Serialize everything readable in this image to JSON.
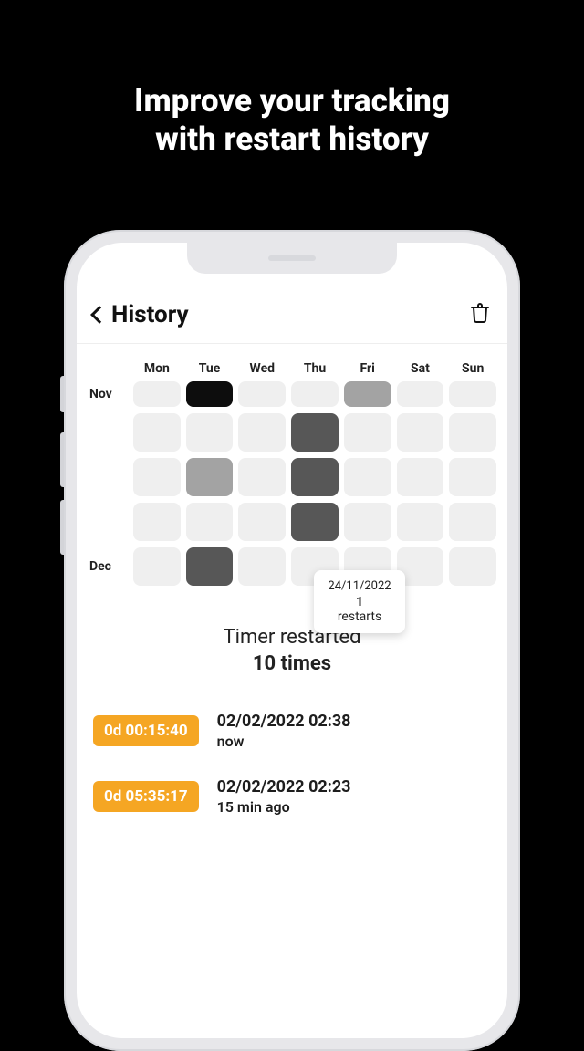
{
  "hero": {
    "line1": "Improve your tracking",
    "line2": "with restart history"
  },
  "header": {
    "title": "History"
  },
  "calendar": {
    "dow": [
      "Mon",
      "Tue",
      "Wed",
      "Thu",
      "Fri",
      "Sat",
      "Sun"
    ],
    "months": {
      "nov": "Nov",
      "dec": "Dec"
    },
    "tooltip": {
      "date": "24/11/2022",
      "count": "1",
      "word": "restarts"
    }
  },
  "summary": {
    "line1": "Timer restarted",
    "line2": "10 times"
  },
  "entries": [
    {
      "duration": "0d 00:15:40",
      "timestamp": "02/02/2022 02:38",
      "relative": "now"
    },
    {
      "duration": "0d 05:35:17",
      "timestamp": "02/02/2022 02:23",
      "relative": "15 min ago"
    }
  ]
}
